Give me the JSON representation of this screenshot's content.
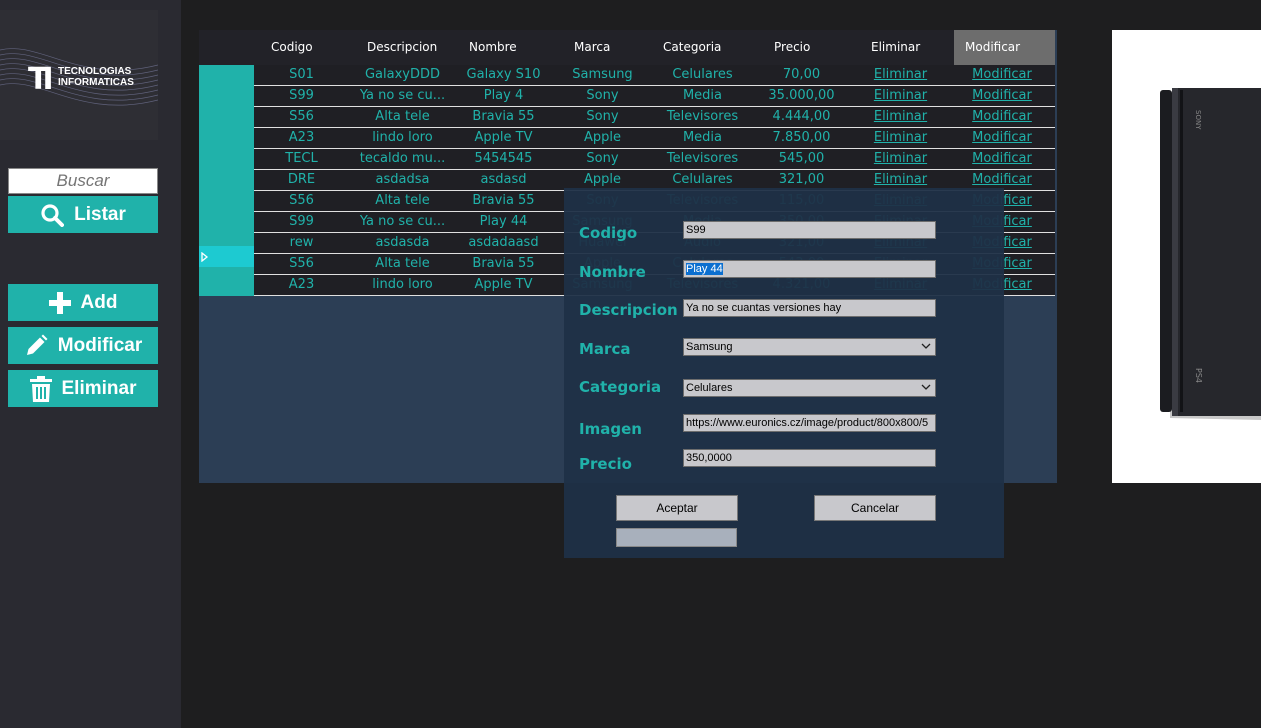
{
  "logo": {
    "mark": "TI",
    "line1": "TECNOLOGIAS",
    "line2": "INFORMATICAS"
  },
  "sidebar": {
    "search_placeholder": "Buscar",
    "listar_label": "Listar",
    "add_label": "Add",
    "modificar_label": "Modificar",
    "eliminar_label": "Eliminar"
  },
  "grid": {
    "headers": [
      "Codigo",
      "Descripcion",
      "Nombre",
      "Marca",
      "Categoria",
      "Precio",
      "Eliminar",
      "Modificar"
    ],
    "rows": [
      {
        "codigo": "S01",
        "descripcion": "GalaxyDDD",
        "nombre": "Galaxy S10",
        "marca": "Samsung",
        "categoria": "Celulares",
        "precio": "70,00",
        "eliminar": "Eliminar",
        "modificar": "Modificar"
      },
      {
        "codigo": "S99",
        "descripcion": "Ya no se cu...",
        "nombre": "Play 4",
        "marca": "Sony",
        "categoria": "Media",
        "precio": "35.000,00",
        "eliminar": "Eliminar",
        "modificar": "Modificar"
      },
      {
        "codigo": "S56",
        "descripcion": "Alta tele",
        "nombre": "Bravia 55",
        "marca": "Sony",
        "categoria": "Televisores",
        "precio": "4.444,00",
        "eliminar": "Eliminar",
        "modificar": "Modificar"
      },
      {
        "codigo": "A23",
        "descripcion": "lindo loro",
        "nombre": "Apple TV",
        "marca": "Apple",
        "categoria": "Media",
        "precio": "7.850,00",
        "eliminar": "Eliminar",
        "modificar": "Modificar"
      },
      {
        "codigo": "TECL",
        "descripcion": "tecaldo mu...",
        "nombre": "5454545",
        "marca": "Sony",
        "categoria": "Televisores",
        "precio": "545,00",
        "eliminar": "Eliminar",
        "modificar": "Modificar"
      },
      {
        "codigo": "DRE",
        "descripcion": "asdadsa",
        "nombre": "asdasd",
        "marca": "Apple",
        "categoria": "Celulares",
        "precio": "321,00",
        "eliminar": "Eliminar",
        "modificar": "Modificar"
      },
      {
        "codigo": "S56",
        "descripcion": "Alta tele",
        "nombre": "Bravia 55",
        "marca": "Sony",
        "categoria": "Televisores",
        "precio": "115,00",
        "eliminar": "Eliminar",
        "modificar": "Modificar"
      },
      {
        "codigo": "S99",
        "descripcion": "Ya no se cu...",
        "nombre": "Play 44",
        "marca": "Samsung",
        "categoria": "Media",
        "precio": "350,00",
        "eliminar": "Eliminar",
        "modificar": "Modificar"
      },
      {
        "codigo": "rew",
        "descripcion": "asdasda",
        "nombre": "asdadaasd",
        "marca": "Huawei",
        "categoria": "Audio",
        "precio": "321,00",
        "eliminar": "Eliminar",
        "modificar": "Modificar"
      },
      {
        "codigo": "S56",
        "descripcion": "Alta tele",
        "nombre": "Bravia 55",
        "marca": "Apple",
        "categoria": "Celulares",
        "precio": "543,00",
        "eliminar": "Eliminar",
        "modificar": "Modificar"
      },
      {
        "codigo": "A23",
        "descripcion": "lindo loro",
        "nombre": "Apple TV",
        "marca": "Samsung",
        "categoria": "Televisores",
        "precio": "4.321,00",
        "eliminar": "Eliminar",
        "modificar": "Modificar"
      }
    ]
  },
  "dialog": {
    "labels": {
      "codigo": "Codigo",
      "nombre": "Nombre",
      "descripcion": "Descripcion",
      "marca": "Marca",
      "categoria": "Categoria",
      "imagen": "Imagen",
      "precio": "Precio"
    },
    "values": {
      "codigo": "S99",
      "nombre": "Play 44",
      "descripcion": "Ya no se cuantas versiones hay",
      "marca": "Samsung",
      "categoria": "Celulares",
      "imagen": "https://www.euronics.cz/image/product/800x800/5",
      "precio": "350,0000"
    },
    "aceptar_label": "Aceptar",
    "cancelar_label": "Cancelar"
  },
  "colors": {
    "accent": "#20b2aa",
    "background": "#1e1e1f",
    "sidebar": "#2a2a31",
    "panel": "#2c3e55",
    "dialog": "#1f3047"
  },
  "icons": [
    "search-icon",
    "plus-icon",
    "pencil-icon",
    "trash-icon",
    "row-pointer-icon",
    "chevron-down-icon"
  ]
}
